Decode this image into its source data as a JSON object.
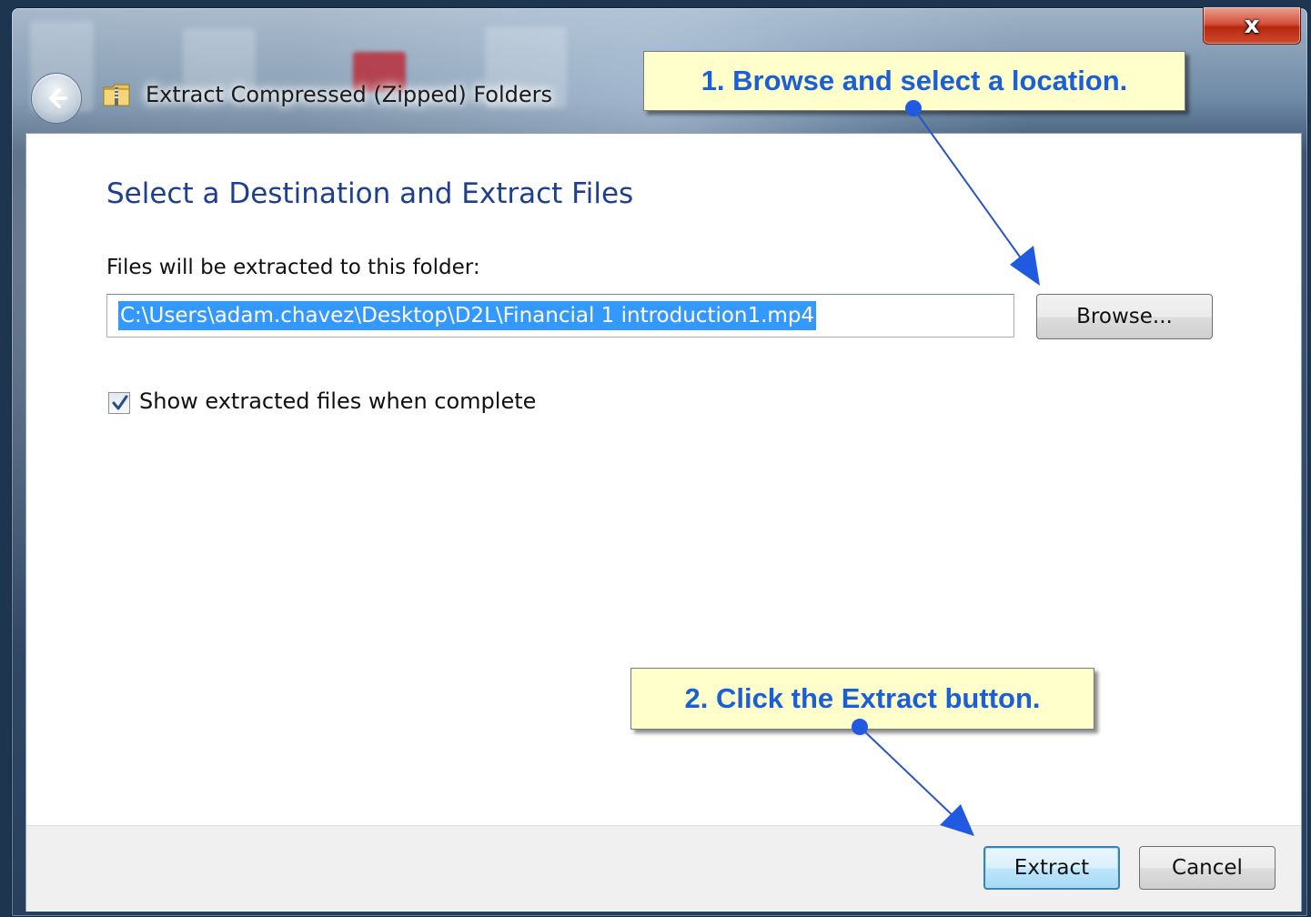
{
  "window": {
    "title": "Extract Compressed (Zipped) Folders",
    "close_label": "x"
  },
  "dialog": {
    "heading": "Select a Destination and Extract Files",
    "folder_label": "Files will be extracted to this folder:",
    "path_value": "C:\\Users\\adam.chavez\\Desktop\\D2L\\Financial 1 introduction1.mp4",
    "browse_label": "Browse...",
    "show_files_checked": true,
    "show_files_label": "Show extracted files when complete"
  },
  "footer": {
    "extract_label": "Extract",
    "cancel_label": "Cancel"
  },
  "callouts": {
    "step1": "1. Browse and select a location.",
    "step2": "2. Click the Extract button."
  },
  "colors": {
    "heading": "#1e3f8f",
    "callout_text": "#1a5fd6",
    "callout_bg": "#ffffcc",
    "selection": "#3399ff",
    "close_red": "#c4391d"
  },
  "icons": [
    "back-arrow-icon",
    "zip-folder-icon",
    "checkmark-icon",
    "close-icon"
  ]
}
